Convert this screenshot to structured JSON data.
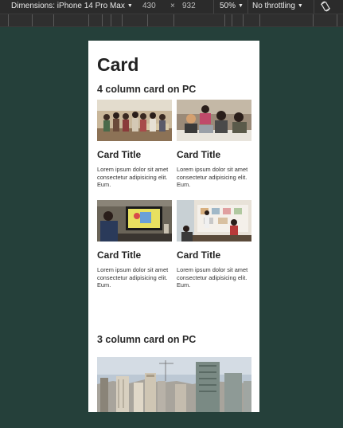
{
  "toolbar": {
    "dimensions_label": "Dimensions: iPhone 14 Pro Max",
    "width": "430",
    "times": "×",
    "height": "932",
    "zoom": "50%",
    "throttling": "No throttling"
  },
  "page": {
    "title": "Card",
    "sections": [
      {
        "title": "4 column card on PC",
        "cards": [
          {
            "title": "Card Title",
            "text": "Lorem ipsum dolor sit amet consectetur adipisicing elit. Eum."
          },
          {
            "title": "Card Title",
            "text": "Lorem ipsum dolor sit amet consectetur adipisicing elit. Eum."
          },
          {
            "title": "Card Title",
            "text": "Lorem ipsum dolor sit amet consectetur adipisicing elit. Eum."
          },
          {
            "title": "Card Title",
            "text": "Lorem ipsum dolor sit amet consectetur adipisicing elit. Eum."
          }
        ]
      },
      {
        "title": "3 column card on PC"
      }
    ]
  }
}
